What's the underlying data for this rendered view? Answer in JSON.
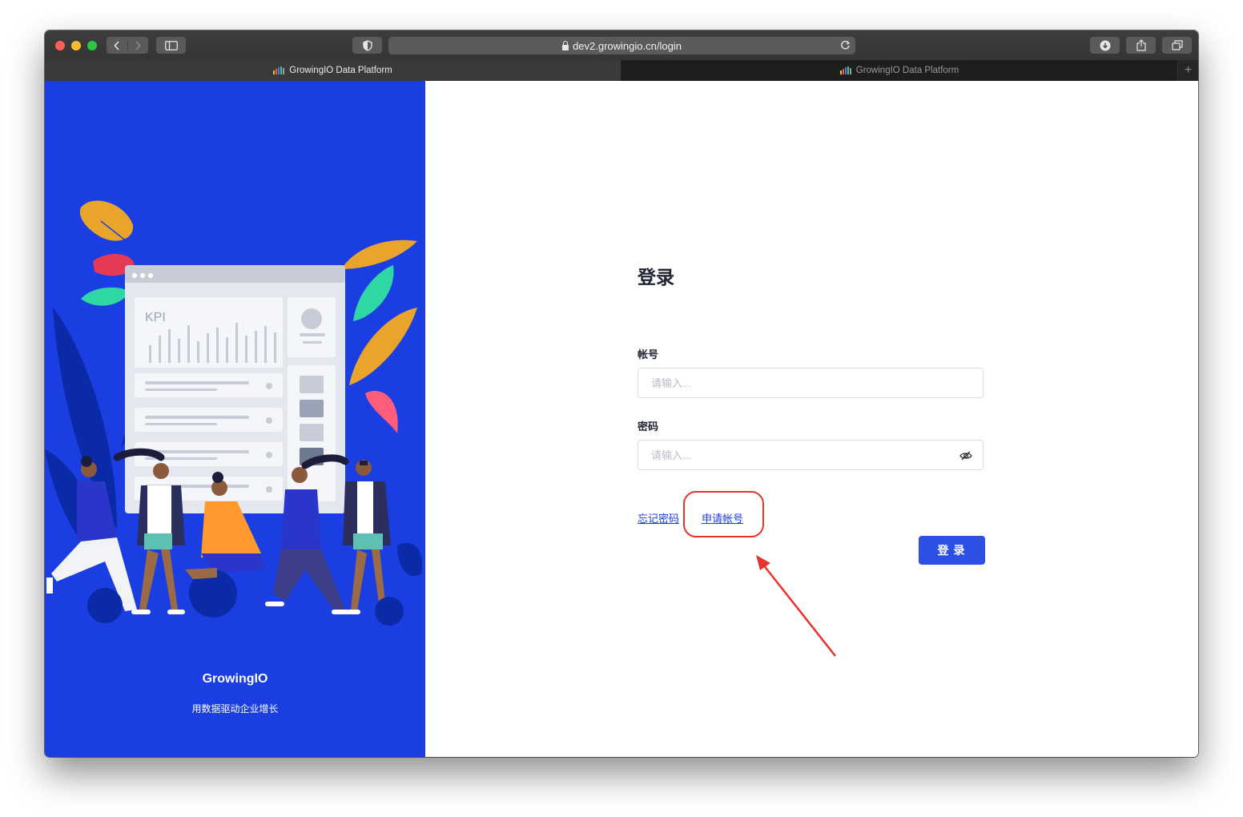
{
  "browser": {
    "url": "dev2.growingio.cn/login",
    "tabs": [
      {
        "title": "GrowingIO Data Platform",
        "active": true
      },
      {
        "title": "GrowingIO Data Platform",
        "active": false
      }
    ],
    "toolbar_icons": [
      "back-icon",
      "forward-icon",
      "sidebar-icon",
      "shield-icon",
      "reload-icon",
      "download-icon",
      "share-icon",
      "tabs-icon"
    ]
  },
  "left_panel": {
    "illustration_text": "KPI",
    "brand_name": "GrowingIO",
    "slogan": "用数据驱动企业增长",
    "background_color": "#1a3ee2"
  },
  "login_form": {
    "title": "登录",
    "account_label": "帐号",
    "account_placeholder": "请输入...",
    "password_label": "密码",
    "password_placeholder": "请输入...",
    "forgot_password": "忘记密码",
    "apply_account": "申请帐号",
    "submit_label": "登录",
    "accent_color": "#2c50e6"
  },
  "annotation": {
    "highlight_color": "#e8332d",
    "highlighted_item": "申请帐号"
  }
}
